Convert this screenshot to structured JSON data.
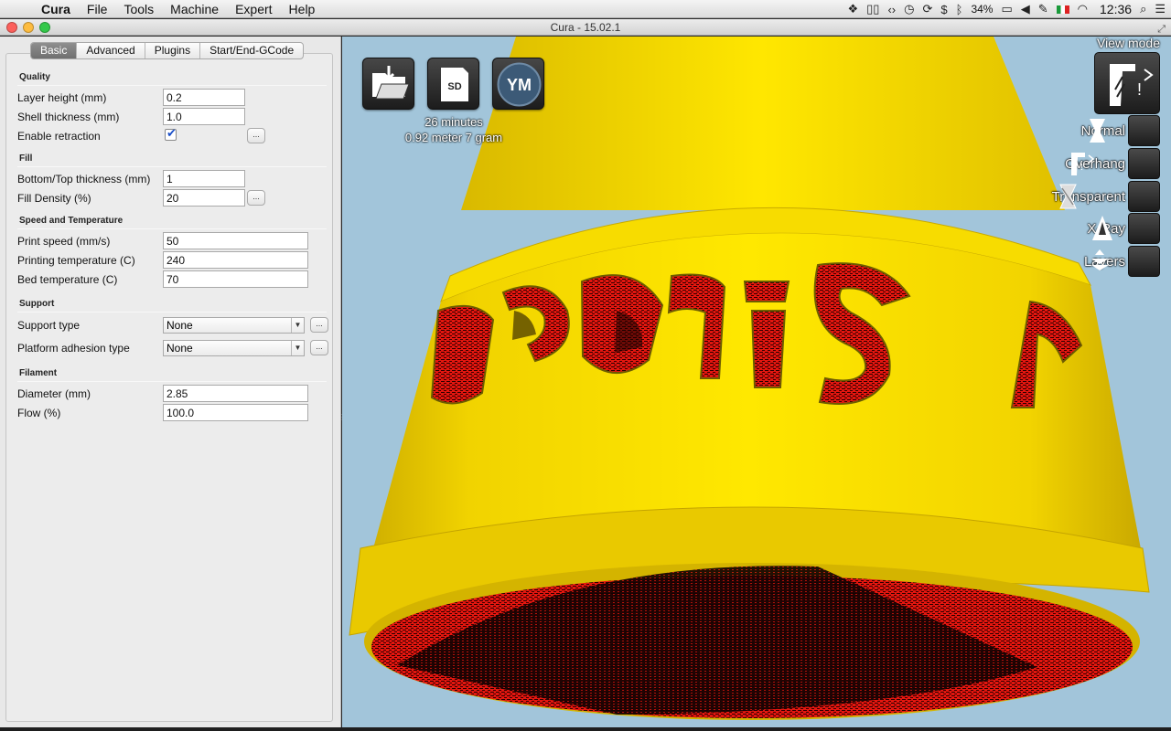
{
  "menubar": {
    "app_name": "Cura",
    "items": [
      "File",
      "Tools",
      "Machine",
      "Expert",
      "Help"
    ],
    "battery": "34%",
    "clock": "12:36"
  },
  "window": {
    "title": "Cura - 15.02.1"
  },
  "tabs": [
    "Basic",
    "Advanced",
    "Plugins",
    "Start/End-GCode"
  ],
  "settings": {
    "quality": {
      "header": "Quality",
      "layer_height": {
        "label": "Layer height (mm)",
        "value": "0.2"
      },
      "shell_thickness": {
        "label": "Shell thickness (mm)",
        "value": "1.0"
      },
      "enable_retraction": {
        "label": "Enable retraction",
        "checked": true
      }
    },
    "fill": {
      "header": "Fill",
      "bottom_top_thickness": {
        "label": "Bottom/Top thickness (mm)",
        "value": "1"
      },
      "fill_density": {
        "label": "Fill Density (%)",
        "value": "20"
      }
    },
    "speed": {
      "header": "Speed and Temperature",
      "print_speed": {
        "label": "Print speed (mm/s)",
        "value": "50"
      },
      "printing_temperature": {
        "label": "Printing temperature (C)",
        "value": "240"
      },
      "bed_temperature": {
        "label": "Bed temperature (C)",
        "value": "70"
      }
    },
    "support": {
      "header": "Support",
      "support_type": {
        "label": "Support type",
        "value": "None"
      },
      "platform_adhesion": {
        "label": "Platform adhesion type",
        "value": "None"
      }
    },
    "filament": {
      "header": "Filament",
      "diameter": {
        "label": "Diameter (mm)",
        "value": "2.85"
      },
      "flow": {
        "label": "Flow (%)",
        "value": "100.0"
      }
    },
    "more_button": "..."
  },
  "viewport": {
    "toolbar": {
      "sd_label": "SD",
      "ym_label": "YM"
    },
    "estimate": {
      "time": "26 minutes",
      "material": "0.92 meter 7 gram"
    },
    "view_mode": {
      "title": "View mode",
      "modes": [
        "Normal",
        "Overhang",
        "Transparent",
        "X-Ray",
        "Layers"
      ]
    },
    "model_text": "pals r",
    "colors": {
      "sky": "#a2c5da",
      "model": "#f5d800",
      "overhang": "#e3160f"
    }
  }
}
